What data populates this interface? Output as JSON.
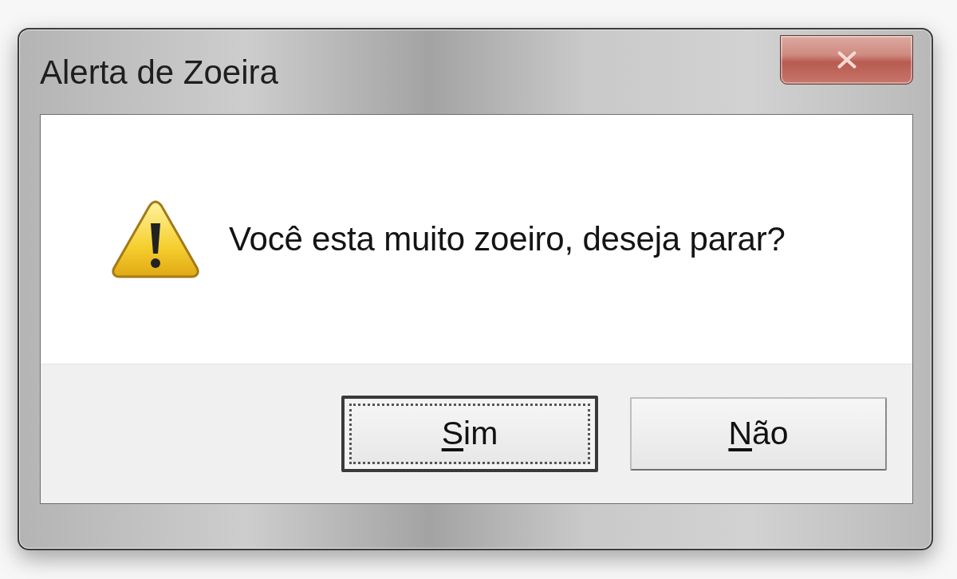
{
  "window": {
    "title": "Alerta de Zoeira"
  },
  "message": {
    "text": "Você esta muito zoeiro, deseja parar?"
  },
  "buttons": [
    {
      "label": "Sim",
      "focused": true
    },
    {
      "label": "Não",
      "focused": false
    }
  ]
}
